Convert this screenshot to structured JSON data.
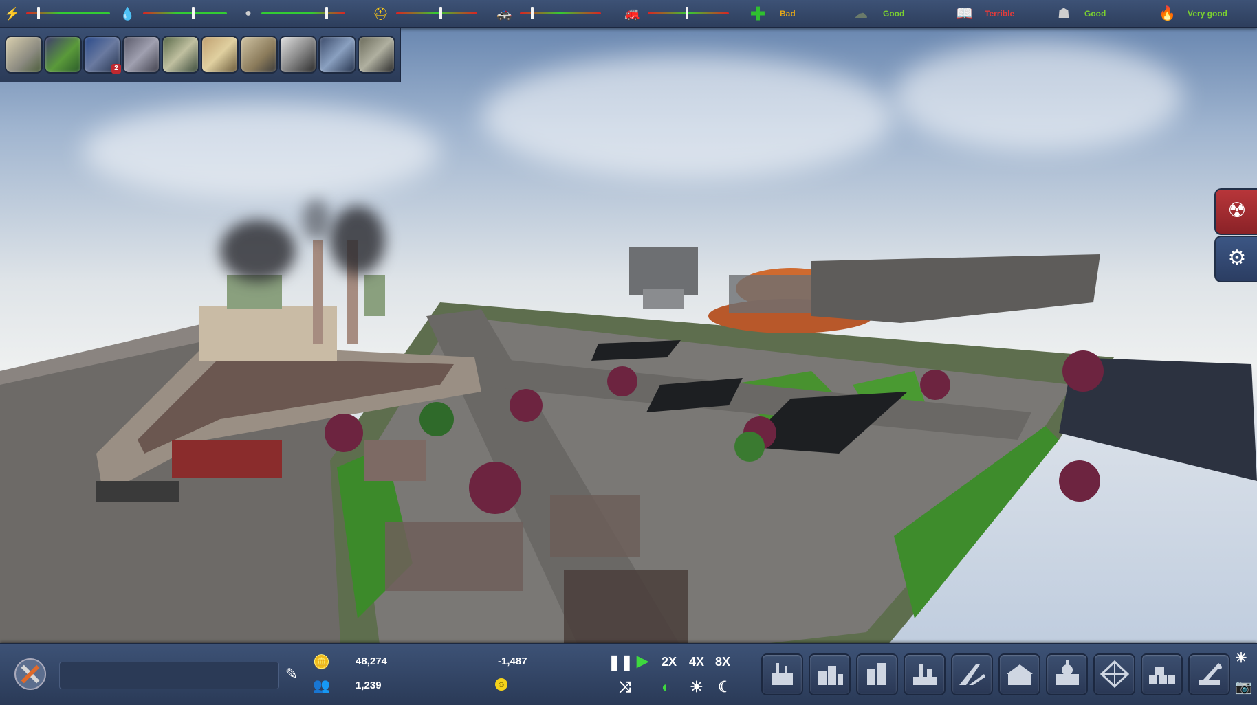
{
  "meters": [
    {
      "icon": "electricity-icon",
      "level_percent": 15
    },
    {
      "icon": "water-icon",
      "level_percent": 60
    },
    {
      "icon": "garbage-icon",
      "level_percent": 78
    },
    {
      "icon": "health-service-icon",
      "level_percent": 55
    },
    {
      "icon": "police-service-icon",
      "level_percent": 15
    },
    {
      "icon": "fire-service-icon",
      "level_percent": 48
    }
  ],
  "stats": [
    {
      "icon": "health-cross-icon",
      "label": "Bad",
      "color": "#e6a817"
    },
    {
      "icon": "pollution-icon",
      "label": "Good",
      "color": "#7bd12f"
    },
    {
      "icon": "education-book-icon",
      "label": "Terrible",
      "color": "#e03b3b"
    },
    {
      "icon": "crime-icon",
      "label": "Good",
      "color": "#7bd12f"
    },
    {
      "icon": "fire-safety-icon",
      "label": "Very good",
      "color": "#7bd12f"
    }
  ],
  "categories": [
    {
      "name": "city-overview"
    },
    {
      "name": "terrain"
    },
    {
      "name": "traffic",
      "badge": "2"
    },
    {
      "name": "districts"
    },
    {
      "name": "economy"
    },
    {
      "name": "statistics-graph"
    },
    {
      "name": "policies-document"
    },
    {
      "name": "resources"
    },
    {
      "name": "research-flask"
    },
    {
      "name": "library"
    }
  ],
  "bottom": {
    "city_name_placeholder": "",
    "money": "48,274",
    "population": "1,239",
    "income": "-1,487",
    "speed_2x": "2X",
    "speed_4x": "4X",
    "speed_8x": "8X"
  },
  "build_tools": [
    {
      "name": "power-plant-build-icon"
    },
    {
      "name": "residential-build-icon"
    },
    {
      "name": "commercial-build-icon"
    },
    {
      "name": "industrial-build-icon"
    },
    {
      "name": "road-build-icon"
    },
    {
      "name": "services-build-icon"
    },
    {
      "name": "government-build-icon"
    },
    {
      "name": "structure-build-icon"
    },
    {
      "name": "storage-build-icon"
    },
    {
      "name": "demolish-crane-icon"
    }
  ],
  "colors": {
    "bar_bg": "#2f4163",
    "accent_green": "#7bd12f",
    "accent_red": "#e03b3b",
    "accent_orange": "#e6a817"
  }
}
